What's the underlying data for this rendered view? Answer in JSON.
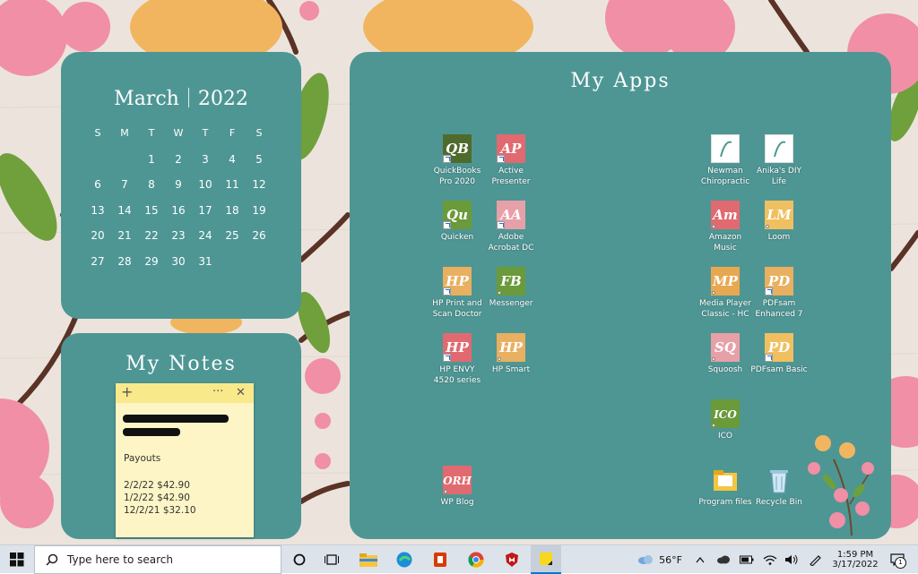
{
  "calendar": {
    "month": "March",
    "year": "2022",
    "weekdays": [
      "S",
      "M",
      "T",
      "W",
      "T",
      "F",
      "S"
    ],
    "days": [
      "",
      "",
      "1",
      "2",
      "3",
      "4",
      "5",
      "6",
      "7",
      "8",
      "9",
      "10",
      "11",
      "12",
      "13",
      "14",
      "15",
      "16",
      "17",
      "18",
      "19",
      "20",
      "21",
      "22",
      "23",
      "24",
      "25",
      "26",
      "27",
      "28",
      "29",
      "30",
      "31"
    ]
  },
  "notes": {
    "title": "My Notes",
    "add_glyph": "+",
    "menu_glyph": "···",
    "close_glyph": "✕",
    "lines": [
      "Payouts",
      "2/2/22  $42.90",
      "1/2/22  $42.90",
      "12/2/21  $32.10"
    ]
  },
  "apps": {
    "title": "My Apps",
    "items": [
      {
        "label": "QuickBooks Pro 2020",
        "abbr": "QB",
        "color": "#4f6b2c",
        "badge": "shortcut"
      },
      {
        "label": "Active Presenter",
        "abbr": "AP",
        "color": "#e06a70",
        "badge": "shortcut"
      },
      {
        "label": "Quicken",
        "abbr": "Qu",
        "color": "#6a9a3a",
        "badge": "shortcut"
      },
      {
        "label": "Adobe Acrobat DC",
        "abbr": "AA",
        "color": "#e8a0a8",
        "badge": "shortcut"
      },
      {
        "label": "HP Print and Scan Doctor",
        "abbr": "HP",
        "color": "#e8b060",
        "badge": "shortcut"
      },
      {
        "label": "Messenger",
        "abbr": "FB",
        "color": "#6a9a3a",
        "badge": "dot"
      },
      {
        "label": "HP ENVY 4520 series",
        "abbr": "HP",
        "color": "#e06a70",
        "badge": "shortcut"
      },
      {
        "label": "HP Smart",
        "abbr": "HP",
        "color": "#e8b060",
        "badge": "dot"
      },
      {
        "label": "WP Blog",
        "abbr": "ORH",
        "color": "#e06a70",
        "badge": "dot"
      },
      {
        "label": "Newman Chiropractic",
        "abbr": "",
        "color": "#ffffff",
        "badge": "none"
      },
      {
        "label": "Anika's DIY Life",
        "abbr": "",
        "color": "#ffffff",
        "badge": "none"
      },
      {
        "label": "Amazon Music",
        "abbr": "Am",
        "color": "#e06a70",
        "badge": "dot"
      },
      {
        "label": "Loom",
        "abbr": "LM",
        "color": "#f0c060",
        "badge": "dot"
      },
      {
        "label": "Media Player Classic - HC",
        "abbr": "MP",
        "color": "#e8a850",
        "badge": "dot"
      },
      {
        "label": "PDFsam Enhanced 7",
        "abbr": "PD",
        "color": "#e8b060",
        "badge": "shortcut"
      },
      {
        "label": "Squoosh",
        "abbr": "SQ",
        "color": "#e8a0a8",
        "badge": "dot"
      },
      {
        "label": "PDFsam Basic",
        "abbr": "PD",
        "color": "#f0c060",
        "badge": "shortcut"
      },
      {
        "label": "ICO",
        "abbr": "ICO",
        "color": "#6a9a3a",
        "badge": "dot"
      },
      {
        "label": "Program files",
        "abbr": "",
        "color": "#f5d47a",
        "badge": "none"
      },
      {
        "label": "Recycle Bin",
        "abbr": "",
        "color": "#cfe8f5",
        "badge": "none"
      }
    ]
  },
  "taskbar": {
    "search_placeholder": "Type here to search",
    "weather_temp": "56°F",
    "time": "1:59 PM",
    "date": "3/17/2022",
    "notification_count": "1",
    "accent": "#0078d4"
  }
}
